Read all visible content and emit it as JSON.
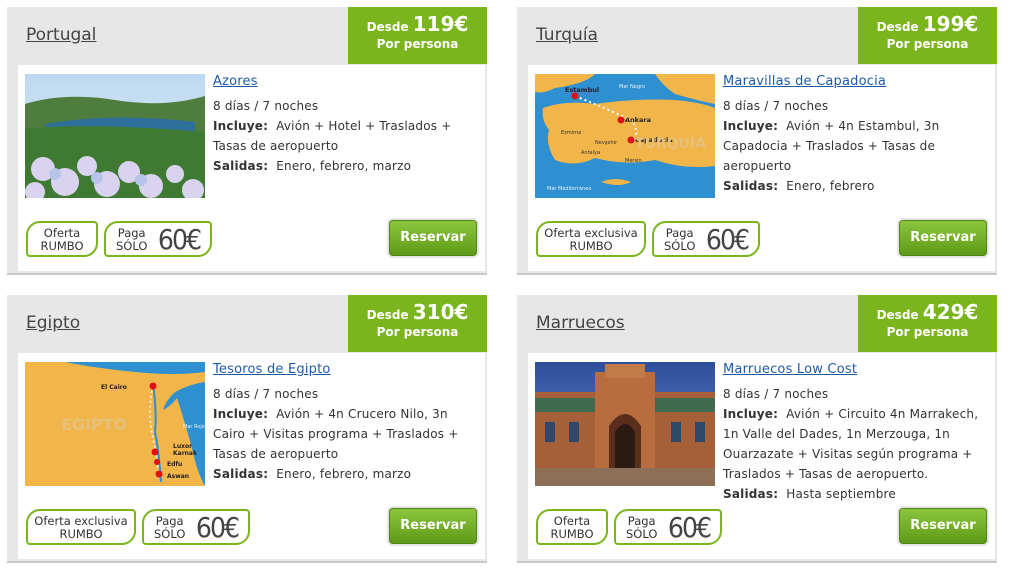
{
  "price_prefix": "Desde",
  "per_person": "Por persona",
  "offer_short": "Oferta\nRUMBO",
  "offer_long": "Oferta exclusiva\nRUMBO",
  "paga": "Paga\nSÓLO",
  "paga_amount": "60€",
  "reserve_label": "Reservar",
  "labels": {
    "incluye": "Incluye:",
    "salidas": "Salidas:"
  },
  "colors": {
    "accent": "#7ab51d",
    "link": "#1f5aa6",
    "card_bg": "#e7e7e7"
  },
  "cards": [
    {
      "destination": "Portugal",
      "price": "119€",
      "trip_title": "Azores",
      "duration": "8  días / 7  noches",
      "includes": "Avión + Hotel + Traslados + Tasas de aeropuerto",
      "departures": "Enero, febrero, marzo",
      "offer": "short"
    },
    {
      "destination": "Turquía",
      "price": "199€",
      "trip_title": "Maravillas de Capadocia",
      "duration": "8  días / 7  noches",
      "includes": "Avión + 4n Estambul, 3n Capadocia + Traslados + Tasas de aeropuerto",
      "departures": "Enero, febrero",
      "offer": "long",
      "map_labels": [
        "Estambul",
        "Ankara",
        "Capadocia",
        "Mar Negro",
        "Esmirna",
        "Antalya",
        "Nevşehir",
        "Mersin",
        "Mar Mediterráneo",
        "TURQUÍA"
      ]
    },
    {
      "destination": "Egipto",
      "price": "310€",
      "trip_title": "Tesoros de Egipto",
      "duration": "8  días / 7  noches",
      "includes": "Avión + 4n Crucero Nilo, 3n Cairo + Visitas programa + Traslados + Tasas de aeropuerto",
      "departures": "Enero, febrero, marzo",
      "offer": "long",
      "map_labels": [
        "El Cairo",
        "Luxor",
        "Karnak",
        "Edfu",
        "Aswan",
        "Mar Rojo",
        "EGIPTO"
      ]
    },
    {
      "destination": "Marruecos",
      "price": "429€",
      "trip_title": "Marruecos Low Cost",
      "duration": "8  días / 7  noches",
      "includes": "Avión + Circuito 4n Marrakech, 1n Valle del Dades, 1n Merzouga, 1n Ouarzazate + Visitas según programa + Traslados + Tasas de aeropuerto.",
      "departures": "Hasta septiembre",
      "offer": "short"
    }
  ]
}
